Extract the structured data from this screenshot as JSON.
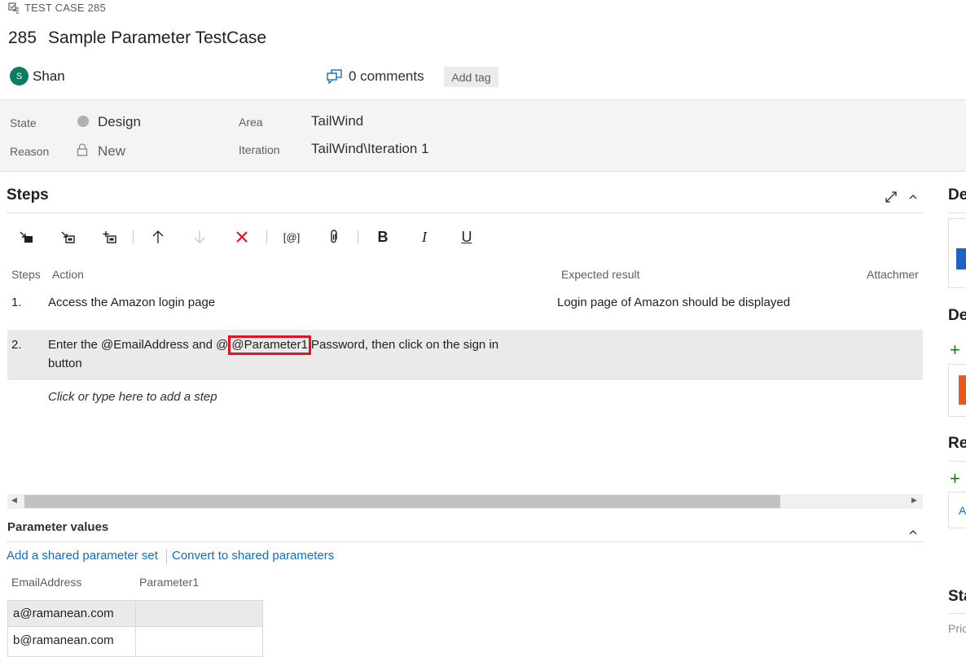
{
  "header": {
    "type_label": "TEST CASE 285",
    "id": "285",
    "title": "Sample Parameter TestCase",
    "assignee_initial": "S",
    "assignee_name": "Shan",
    "comments": "0 comments",
    "add_tag": "Add tag"
  },
  "details": {
    "state_label": "State",
    "state_value": "Design",
    "reason_label": "Reason",
    "reason_value": "New",
    "area_label": "Area",
    "area_value": "TailWind",
    "iteration_label": "Iteration",
    "iteration_value": "TailWind\\Iteration 1"
  },
  "steps": {
    "title": "Steps",
    "toolbar": {
      "bold": "B",
      "italic": "I",
      "underline": "U",
      "insert_parameter": "[@]"
    },
    "columns": {
      "steps": "Steps",
      "action": "Action",
      "expected": "Expected result",
      "attachments": "Attachmer"
    },
    "rows": [
      {
        "num": "1.",
        "action": "Access the Amazon login page",
        "expected": "Login page of Amazon should be displayed"
      },
      {
        "num": "2.",
        "action_before": "Enter the @EmailAddress and @",
        "action_param": "@Parameter1",
        "action_after": "Password, then click on the sign in",
        "action_line2": "button",
        "expected": ""
      }
    ],
    "add_step": "Click or type here to add a step"
  },
  "parameters": {
    "title": "Parameter values",
    "add_shared": "Add a shared parameter set",
    "convert": "Convert to shared parameters",
    "columns": [
      "EmailAddress",
      "Parameter1"
    ],
    "rows": [
      [
        "a@ramanean.com",
        ""
      ],
      [
        "b@ramanean.com",
        ""
      ]
    ]
  },
  "right_panel": {
    "section1": "De",
    "section2": "De",
    "section3": "Re",
    "link3": "A",
    "section4": "Sta",
    "field4": "Pric"
  },
  "colors": {
    "accent": "#106ebe",
    "avatar": "#0e7b63",
    "delete": "#e81123",
    "highlight_border": "#e81123",
    "add": "#107c10"
  }
}
